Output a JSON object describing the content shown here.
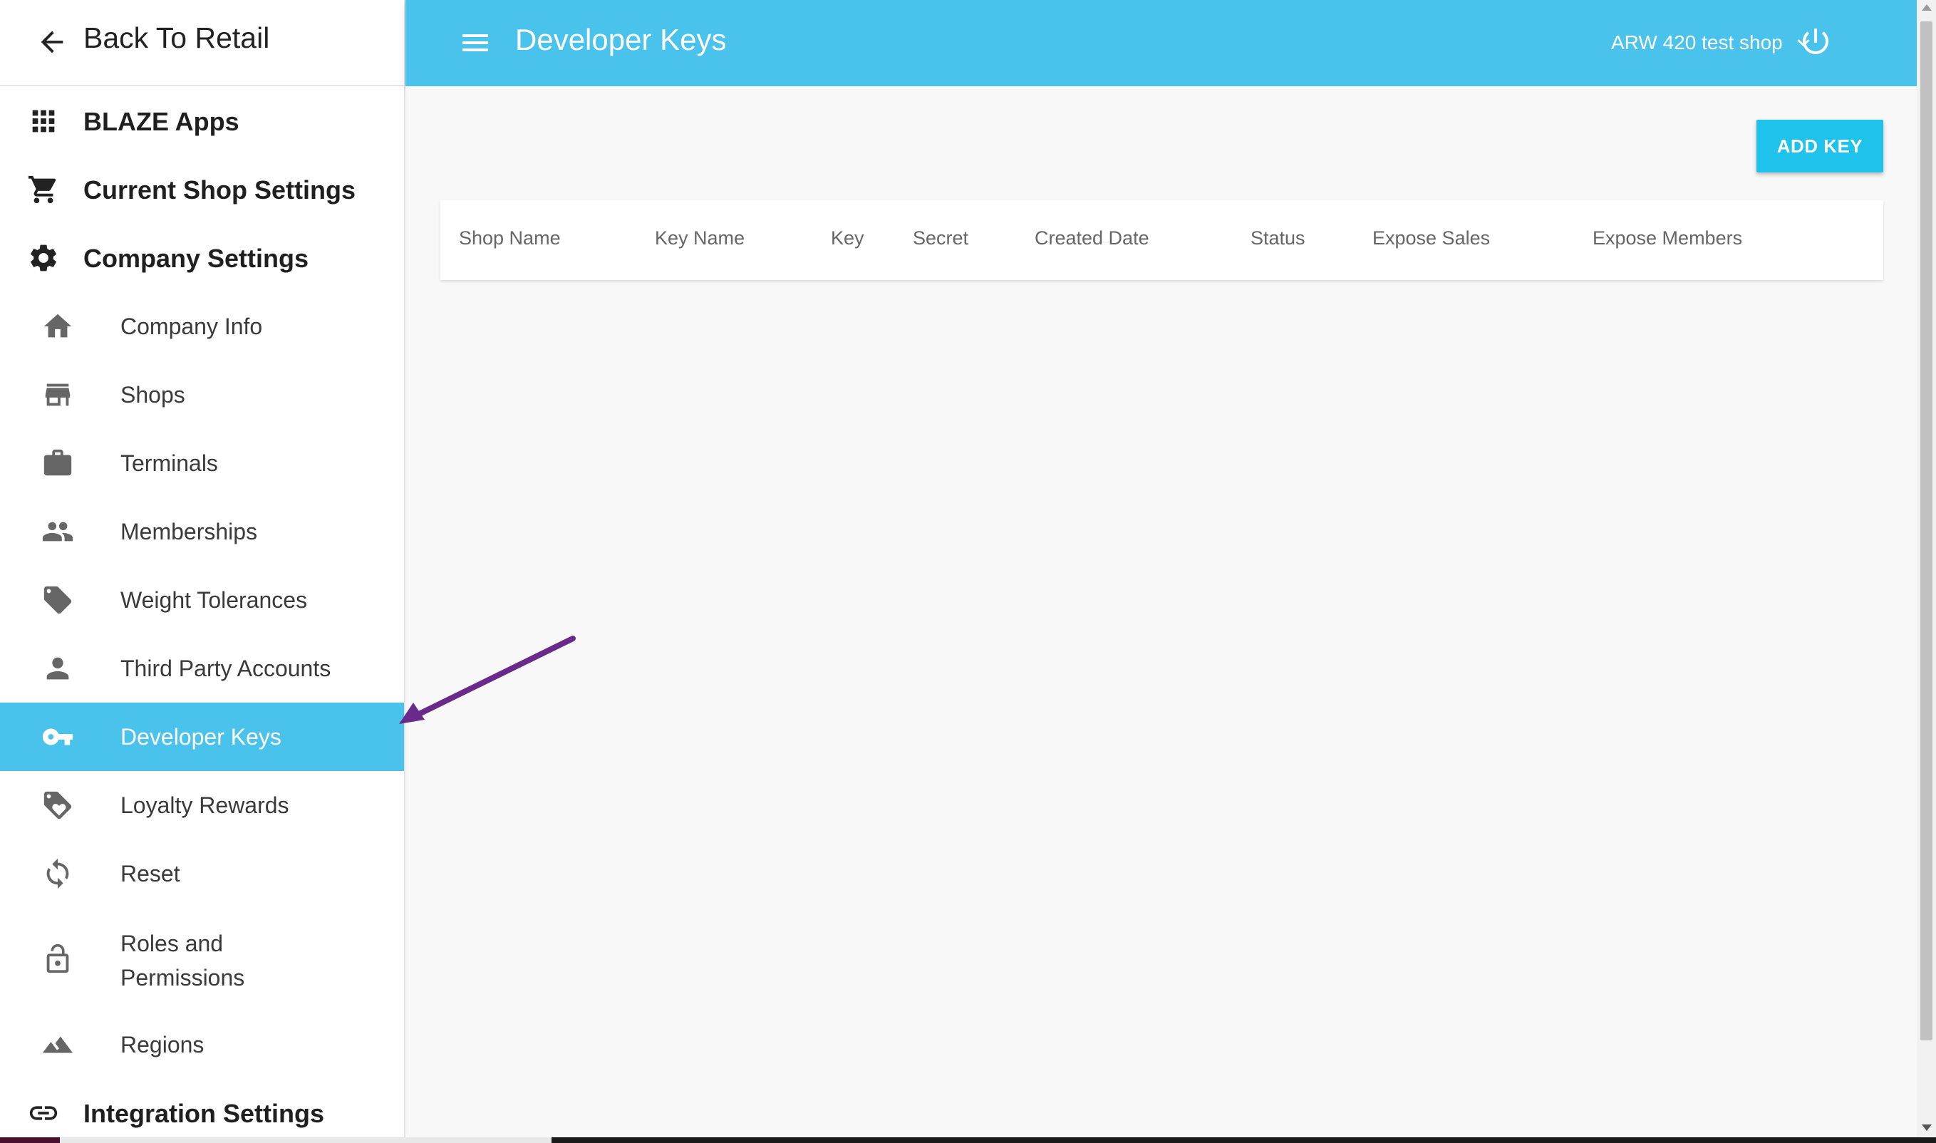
{
  "sidebar": {
    "back_label": "Back To Retail",
    "items": [
      {
        "label": "BLAZE Apps",
        "icon": "apps-grid-icon"
      },
      {
        "label": "Current Shop Settings",
        "icon": "cart-icon"
      },
      {
        "label": "Company Settings",
        "icon": "gear-icon"
      },
      {
        "label": "Company Info",
        "icon": "home-icon"
      },
      {
        "label": "Shops",
        "icon": "store-icon"
      },
      {
        "label": "Terminals",
        "icon": "briefcase-icon"
      },
      {
        "label": "Memberships",
        "icon": "people-icon"
      },
      {
        "label": "Weight Tolerances",
        "icon": "tag-icon"
      },
      {
        "label": "Third Party Accounts",
        "icon": "person-icon"
      },
      {
        "label": "Developer Keys",
        "icon": "key-icon",
        "active": true
      },
      {
        "label": "Loyalty Rewards",
        "icon": "loyalty-icon"
      },
      {
        "label": "Reset",
        "icon": "refresh-icon"
      },
      {
        "label": "Roles and",
        "label_line2": "Permissions",
        "icon": "lock-icon"
      },
      {
        "label": "Regions",
        "icon": "terrain-icon"
      },
      {
        "label": "Integration Settings",
        "icon": "link-icon"
      }
    ]
  },
  "header": {
    "title": "Developer Keys",
    "shop_name": "ARW 420 test shop"
  },
  "content": {
    "add_key_label": "ADD KEY",
    "columns": [
      "Shop Name",
      "Key Name",
      "Key",
      "Secret",
      "Created Date",
      "Status",
      "Expose Sales",
      "Expose Members"
    ]
  },
  "colors": {
    "accent": "#49c3ec",
    "button": "#1fc2ea",
    "annotation_arrow": "#6a2a8c"
  }
}
